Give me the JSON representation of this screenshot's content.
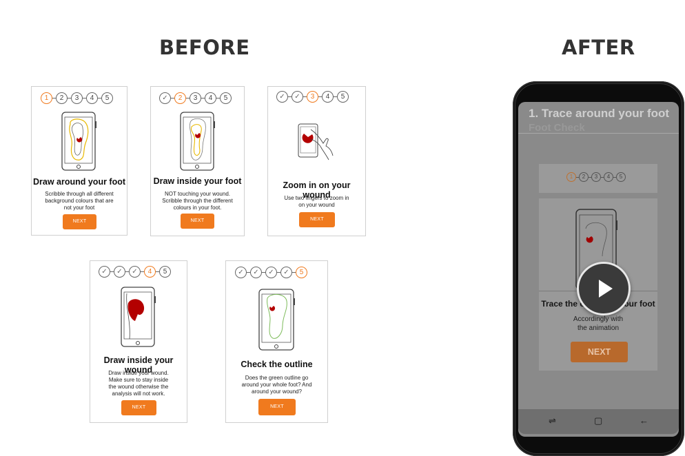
{
  "headings": {
    "before": "BEFORE",
    "after": "AFTER"
  },
  "before_cards": [
    {
      "steps": [
        "1",
        "2",
        "3",
        "4",
        "5"
      ],
      "active_step": 1,
      "title": "Draw around your foot",
      "body": "Scribble through all different\nbackground colours that are\nnot your foot",
      "button": "NEXT"
    },
    {
      "steps": [
        "✓",
        "2",
        "3",
        "4",
        "5"
      ],
      "active_step": 2,
      "title": "Draw inside your foot",
      "body": "NOT touching your wound.\nScribble through the different\ncolours in your foot.",
      "button": "NEXT"
    },
    {
      "steps": [
        "✓",
        "✓",
        "3",
        "4",
        "5"
      ],
      "active_step": 3,
      "title": "Zoom in on your wound",
      "body": "Use two fingers to zoom in\non your wound",
      "button": "NEXT"
    },
    {
      "steps": [
        "✓",
        "✓",
        "✓",
        "4",
        "5"
      ],
      "active_step": 4,
      "title": "Draw inside your wound",
      "body": "Draw inside your wound.\nMake sure to stay inside\nthe wound otherwise the\nanalysis will not work.",
      "button": "NEXT"
    },
    {
      "steps": [
        "✓",
        "✓",
        "✓",
        "✓",
        "5"
      ],
      "active_step": 5,
      "title": "Check the outline",
      "body": "Does the green outline go\naround your whole foot? And\naround your wound?",
      "button": "NEXT"
    }
  ],
  "after_screen": {
    "app_title": "1. Trace around your foot",
    "app_subtitle": "Foot Check",
    "steps": [
      "1",
      "2",
      "3",
      "4",
      "5"
    ],
    "active_step": 1,
    "card_title": "Trace the outline of your foot",
    "card_body": "Accordingly with\nthe animation",
    "button": "NEXT",
    "nav": {
      "recent": "⇌",
      "home": "▢",
      "back": "←"
    }
  },
  "colors": {
    "accent": "#f07a1e",
    "wound": "#b30000",
    "foot_outline_yellow": "#e8b800",
    "check_green": "#7dbb5a"
  },
  "icons": [
    "phone-illustration-icon",
    "foot-outline-icon",
    "wound-icon",
    "pinch-hand-icon",
    "play-icon",
    "recent-apps-icon",
    "home-icon",
    "back-arrow-icon"
  ]
}
